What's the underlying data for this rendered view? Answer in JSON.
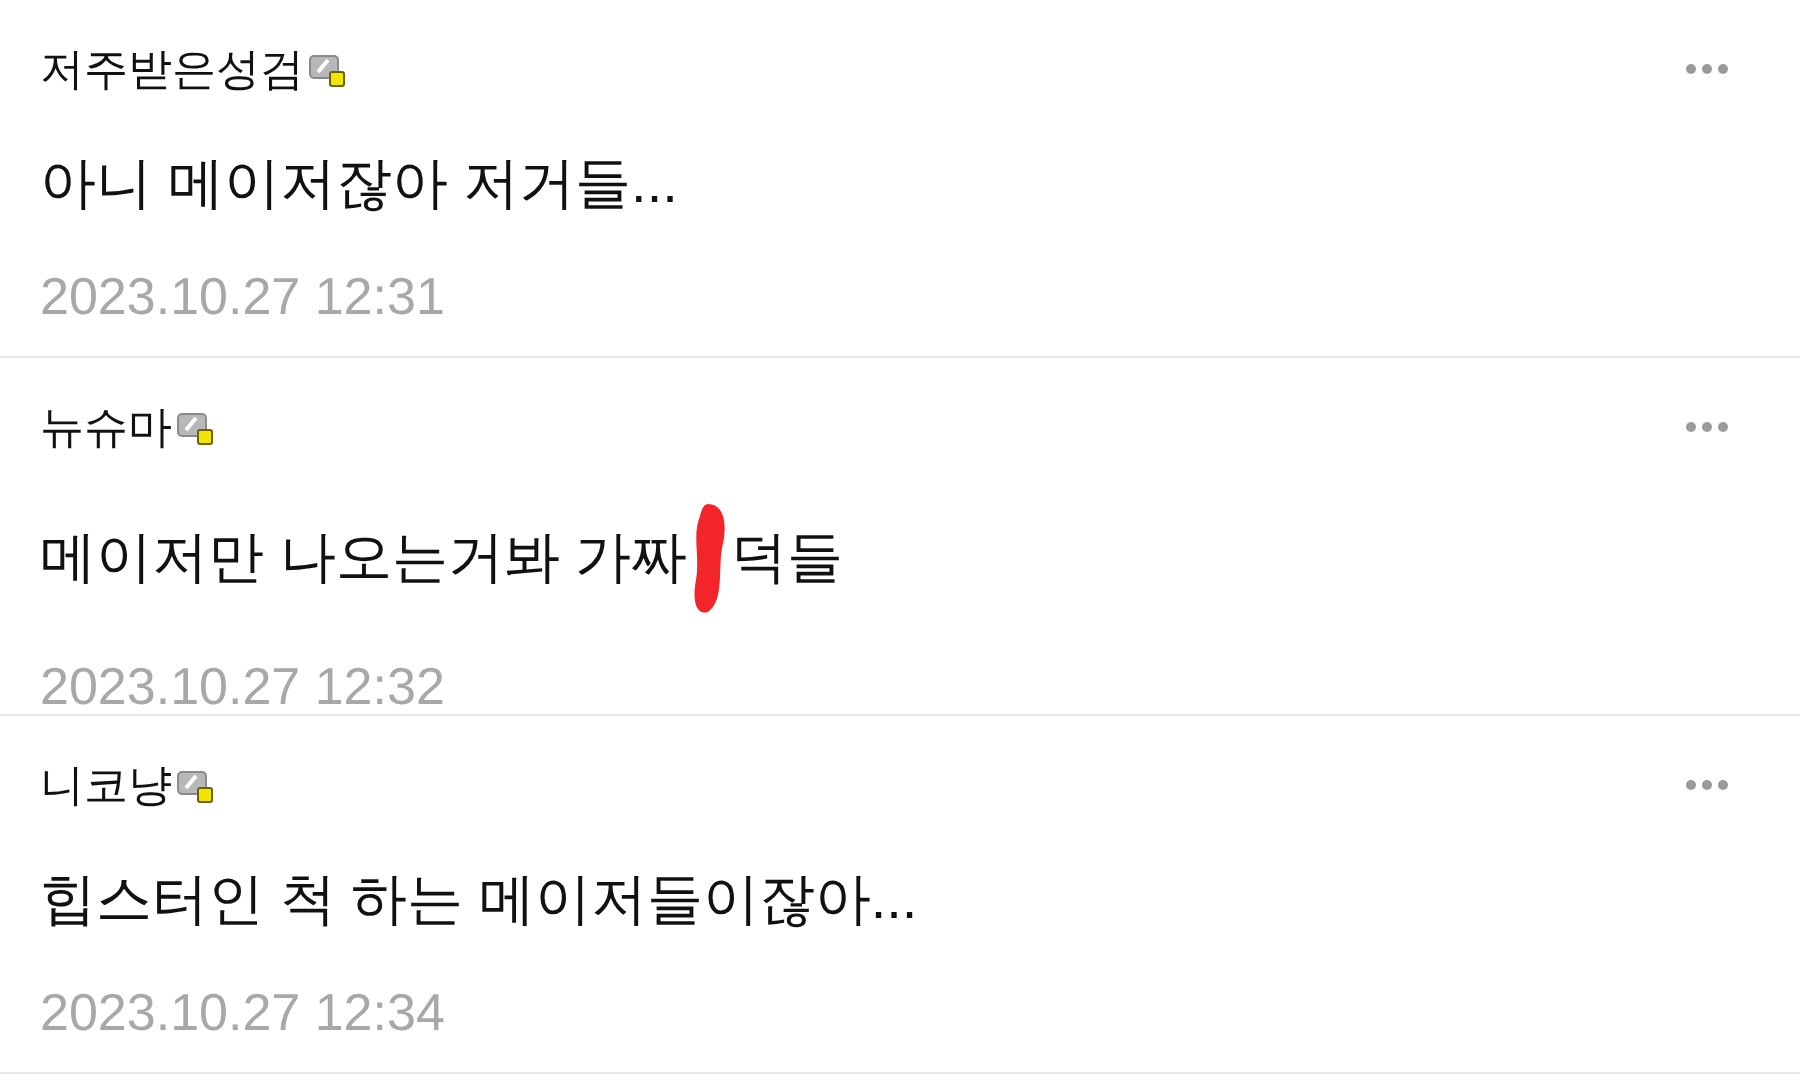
{
  "comments": [
    {
      "author": "저주받은성검",
      "body_before": "아니 메이저잖아 저거들...",
      "redacted": false,
      "time": "2023.10.27 12:31"
    },
    {
      "author": "뉴슈마",
      "body_before": "메이저만 나오는거봐 가짜",
      "redacted": true,
      "body_after": "덕들",
      "time": "2023.10.27 12:32"
    },
    {
      "author": "니코냥",
      "body_before": "힙스터인 척 하는 메이저들이잖아...",
      "redacted": false,
      "time": "2023.10.27 12:34"
    }
  ]
}
